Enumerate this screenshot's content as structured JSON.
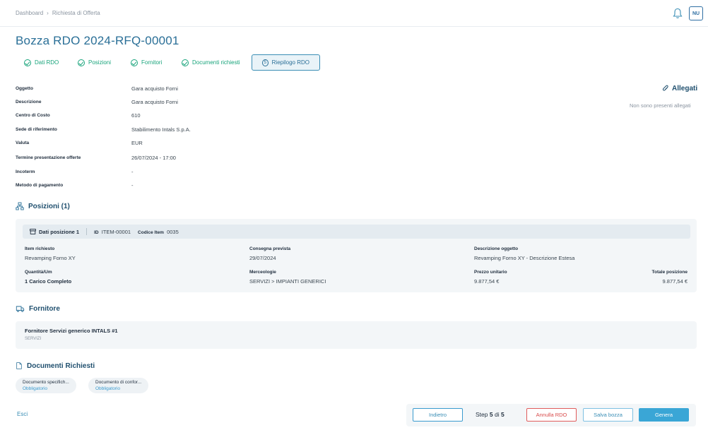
{
  "breadcrumb": {
    "home": "Dashboard",
    "current": "Richiesta di Offerta"
  },
  "user": {
    "initials": "NU"
  },
  "page_title": "Bozza RDO 2024-RFQ-00001",
  "steps": [
    {
      "label": "Dati RDO",
      "state": "done"
    },
    {
      "label": "Posizioni",
      "state": "done"
    },
    {
      "label": "Fornitori",
      "state": "done"
    },
    {
      "label": "Documenti richiesti",
      "state": "done"
    },
    {
      "label": "Riepilogo RDO",
      "state": "active",
      "number": "5"
    }
  ],
  "info": [
    {
      "label": "Oggetto",
      "value": "Gara acquisto Forni"
    },
    {
      "label": "Descrizione",
      "value": "Gara acquisto Forni"
    },
    {
      "label": "Centro di Costo",
      "value": "610"
    },
    {
      "label": "Sede di riferimento",
      "value": "Stabilimento Intals S.p.A."
    },
    {
      "label": "Valuta",
      "value": "EUR"
    },
    {
      "label": "Termine presentazione offerte",
      "value": "26/07/2024 - 17:00"
    },
    {
      "label": "Incoterm",
      "value": "-"
    },
    {
      "label": "Metodo di pagamento",
      "value": "-"
    }
  ],
  "allegati": {
    "title": "Allegati",
    "empty_text": "Non sono presenti allegati"
  },
  "posizioni": {
    "title": "Posizioni (1)",
    "header": {
      "title": "Dati posizione 1",
      "id_label": "ID",
      "id_value": "ITEM-00001",
      "code_label": "Codice Item",
      "code_value": "0035"
    },
    "fields": {
      "item_label": "Item richiesto",
      "item_value": "Revamping Forno XY",
      "consegna_label": "Consegna prevista",
      "consegna_value": "29/07/2024",
      "descr_label": "Descrizione oggetto",
      "descr_value": "Revamping Forno XY - Descrizione Estesa",
      "qty_label": "Quantità/Um",
      "qty_value": "1 Carico Completo",
      "merc_label": "Merceologie",
      "merc_value": "SERVIZI > IMPIANTI GENERICI",
      "prezzo_label": "Prezzo unitario",
      "prezzo_value": "9.877,54 €",
      "totale_label": "Totale posizione",
      "totale_value": "9.877,54 €"
    }
  },
  "fornitore": {
    "title": "Fornitore",
    "name": "Fornitore Servizi generico INTALS #1",
    "category": "SERVIZI"
  },
  "documenti": {
    "title": "Documenti Richiesti",
    "items": [
      {
        "name": "Documento specifich...",
        "status": "Obbligatorio"
      },
      {
        "name": "Documento di confor...",
        "status": "Obbligatorio"
      }
    ]
  },
  "footer": {
    "exit_label": "Esci",
    "back_label": "Indietro",
    "step_prefix": "Step",
    "step_current": "5",
    "step_of": "di",
    "step_total": "5",
    "cancel_label": "Annulla RDO",
    "save_label": "Salva bozza",
    "generate_label": "Genera"
  },
  "colors": {
    "accent": "#2a6f97",
    "success": "#18a47b",
    "danger": "#d84a4a",
    "primary_button": "#3aa6d6"
  }
}
